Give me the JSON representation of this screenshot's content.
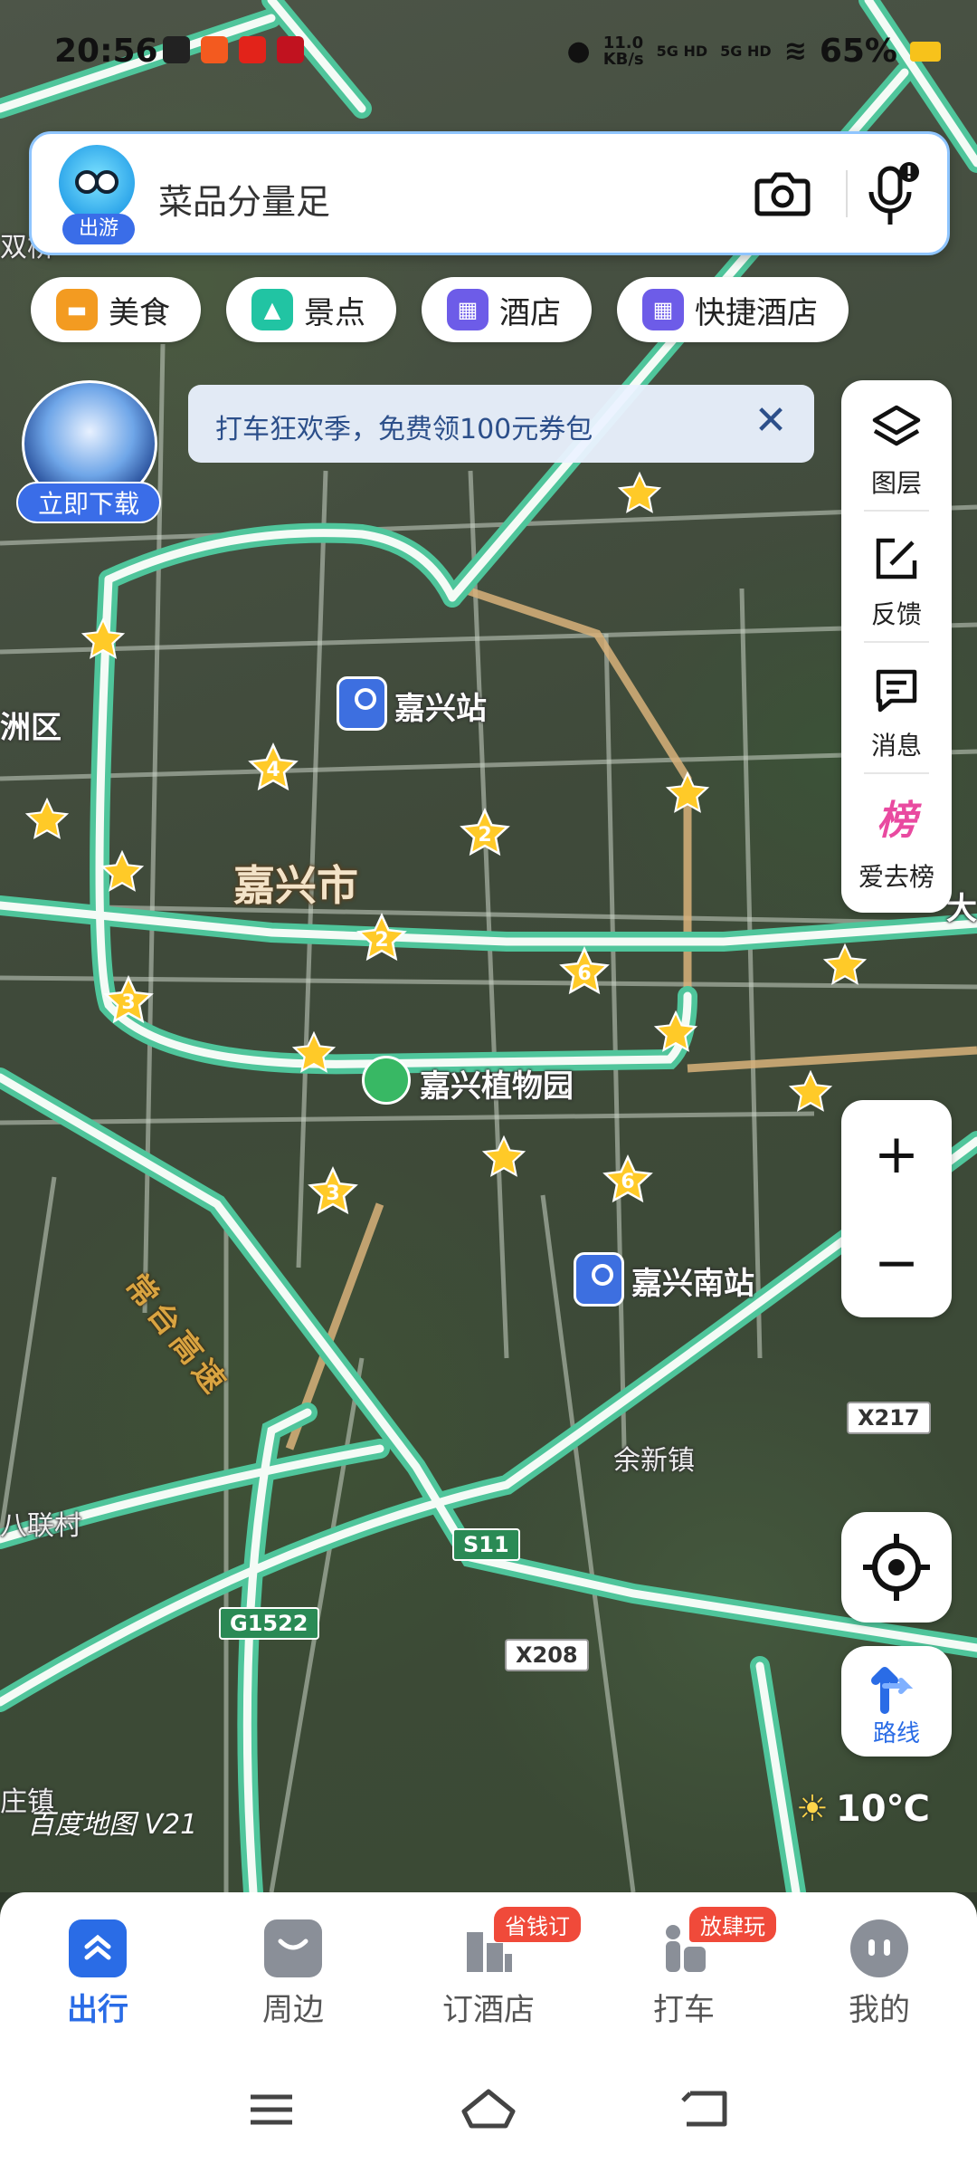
{
  "status_bar": {
    "time": "20:56",
    "net_speed_top": "11.0",
    "net_speed_unit": "KB/s",
    "sim1": "5G HD",
    "sim2": "5G HD",
    "battery": "65%"
  },
  "search": {
    "mode_tag": "出游",
    "placeholder": "菜品分量足"
  },
  "chips": [
    {
      "label": "美食",
      "icon": "food-icon",
      "color": "#f39b21"
    },
    {
      "label": "景点",
      "icon": "scenery-icon",
      "color": "#21c4a3"
    },
    {
      "label": "酒店",
      "icon": "hotel-icon",
      "color": "#6d5ce8"
    },
    {
      "label": "快捷酒店",
      "icon": "budget-hotel-icon",
      "color": "#6d5ce8"
    }
  ],
  "banner": {
    "text": "打车狂欢季，免费领100元券包",
    "close": "✕"
  },
  "ad": {
    "cta": "立即下载"
  },
  "tools": [
    {
      "label": "图层",
      "icon": "layers-icon"
    },
    {
      "label": "反馈",
      "icon": "feedback-icon"
    },
    {
      "label": "消息",
      "icon": "message-icon"
    },
    {
      "label": "爱去榜",
      "icon": "ranking-icon",
      "glyph": "榜"
    }
  ],
  "zoom": {
    "in": "+",
    "out": "−"
  },
  "route": {
    "label": "路线"
  },
  "weather": {
    "temp": "10℃"
  },
  "brand": "百度地图 V21",
  "map": {
    "city": "嘉兴市",
    "labels": {
      "jiaxing_station": "嘉兴站",
      "botanical": "嘉兴植物园",
      "south_station": "嘉兴南站",
      "yuxin": "余新镇",
      "bailian": "八联村",
      "district_partial": "洲区",
      "town_partial": "双桥",
      "town_bottom_left": "庄镇",
      "big_partial": "大",
      "expressway": "常台高速"
    },
    "shields": {
      "x217": "X217",
      "s11": "S11",
      "g1522": "G1522",
      "x208": "X208"
    },
    "star_counts": [
      "4",
      "2",
      "2",
      "6",
      "3",
      "3",
      "6"
    ],
    "colors": {
      "road": "#55d3a8",
      "arterial": "#c9d2c4",
      "star": "#ffca28",
      "accent": "#2a6ce6"
    }
  },
  "bottom_nav": [
    {
      "label": "出行",
      "icon": "travel-icon",
      "active": true
    },
    {
      "label": "周边",
      "icon": "nearby-icon"
    },
    {
      "label": "订酒店",
      "icon": "hotel-booking-icon",
      "badge": "省钱订"
    },
    {
      "label": "打车",
      "icon": "taxi-icon",
      "badge": "放肆玩"
    },
    {
      "label": "我的",
      "icon": "profile-icon"
    }
  ]
}
